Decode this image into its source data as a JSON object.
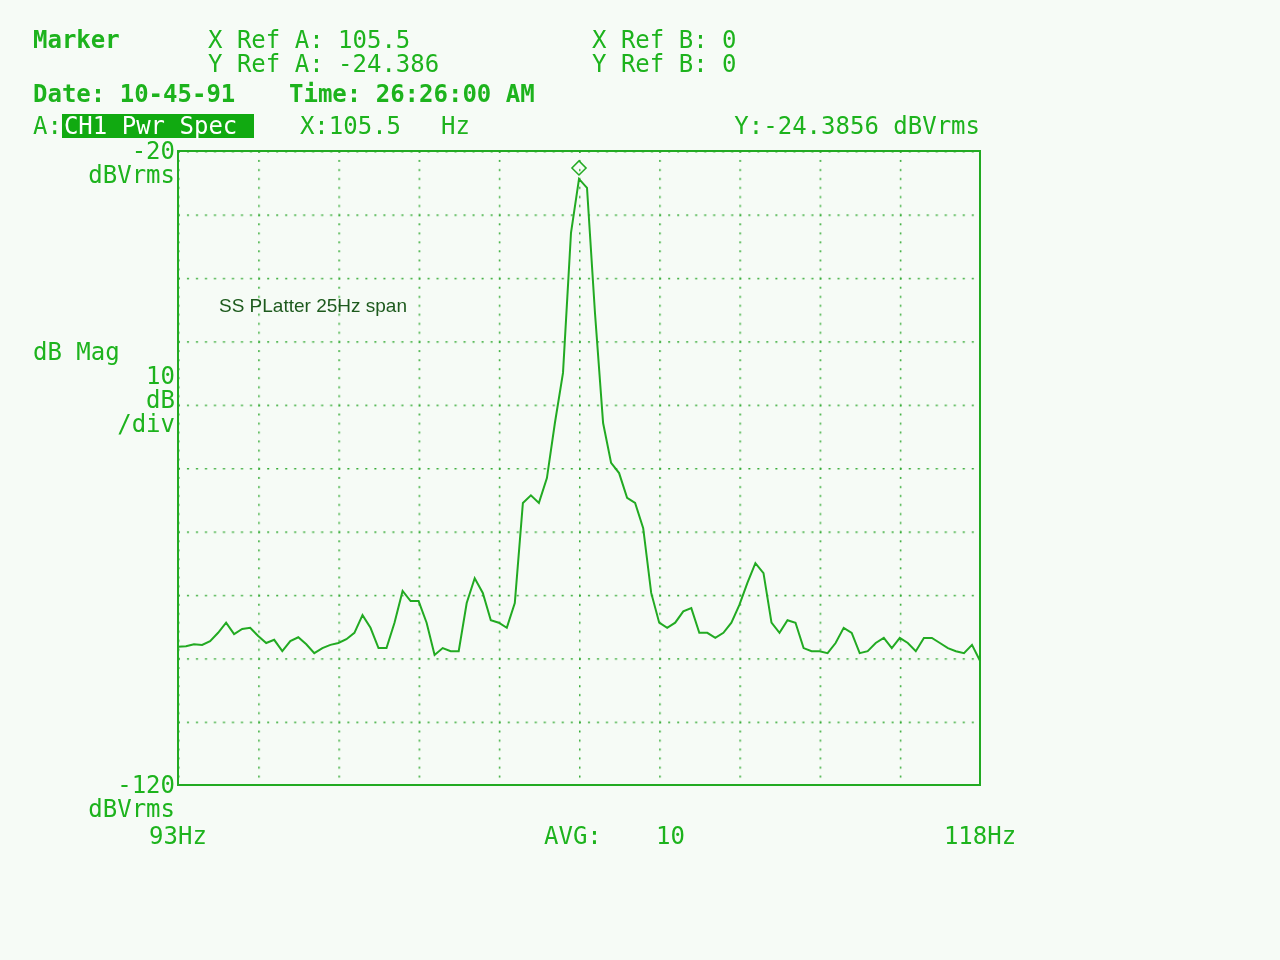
{
  "header": {
    "title": "Marker",
    "refs": [
      {
        "label": "X Ref A:",
        "value": "105.5"
      },
      {
        "label": "X Ref B:",
        "value": "0"
      },
      {
        "label": "Y Ref A:",
        "value": "-24.386"
      },
      {
        "label": "Y Ref B:",
        "value": "0"
      }
    ],
    "date_label": "Date:",
    "date": "10-45-91",
    "time_label": "Time:",
    "time": "26:26:00 AM"
  },
  "trace_bar": {
    "channel": "A:",
    "marker_x": "X:105.5",
    "marker_x_unit": "Hz",
    "marker_y": "Y:-24.3856 dBVrms"
  },
  "axis": {
    "top_unit": "dBVrms",
    "scale_lines": [
      "10",
      "dB",
      "/div"
    ],
    "bottom_unit": "dBVrms"
  },
  "footer": {
    "avg_label": "AVG:",
    "avg_value": "10"
  },
  "chart_data": {
    "type": "line",
    "ylabel": "dB Mag",
    "xlim": [
      93,
      118
    ],
    "ylim": [
      -120,
      -20
    ],
    "xticks": [
      {
        "value": 93,
        "label": "93Hz"
      },
      {
        "value": 118,
        "label": "118Hz"
      }
    ],
    "yticks": [
      {
        "value": -20,
        "label": "-20"
      },
      {
        "value": -120,
        "label": "-120"
      }
    ],
    "x": [
      93,
      93.25,
      93.5,
      93.75,
      94,
      94.25,
      94.5,
      94.75,
      95,
      95.25,
      95.5,
      95.75,
      96,
      96.25,
      96.5,
      96.75,
      97,
      97.25,
      97.5,
      97.75,
      98,
      98.25,
      98.5,
      98.75,
      99,
      99.25,
      99.5,
      99.75,
      100,
      100.25,
      100.5,
      100.75,
      101,
      101.25,
      101.5,
      101.75,
      102,
      102.25,
      102.5,
      102.75,
      103,
      103.25,
      103.5,
      103.75,
      104,
      104.25,
      104.5,
      104.75,
      105,
      105.25,
      105.5,
      105.75,
      106,
      106.25,
      106.5,
      106.75,
      107,
      107.25,
      107.5,
      107.75,
      108,
      108.25,
      108.5,
      108.75,
      109,
      109.25,
      109.5,
      109.75,
      110,
      110.25,
      110.5,
      110.75,
      111,
      111.25,
      111.5,
      111.75,
      112,
      112.25,
      112.5,
      112.75,
      113,
      113.25,
      113.5,
      113.75,
      114,
      114.25,
      114.5,
      114.75,
      115,
      115.25,
      115.5,
      115.75,
      116,
      116.25,
      116.5,
      116.75,
      117,
      117.25,
      117.5,
      117.75,
      118
    ],
    "series": [
      {
        "name": "CH1 Pwr Spec",
        "color": "#22aa22",
        "values": [
          -98.2,
          -98.1,
          -97.8,
          -97.9,
          -97.3,
          -96.0,
          -94.4,
          -96.2,
          -95.4,
          -95.2,
          -96.5,
          -97.6,
          -97.1,
          -98.9,
          -97.3,
          -96.7,
          -97.8,
          -99.2,
          -98.4,
          -97.9,
          -97.6,
          -97.0,
          -96.0,
          -93.2,
          -95.2,
          -98.4,
          -98.4,
          -94.4,
          -89.4,
          -91.0,
          -91.0,
          -94.4,
          -99.5,
          -98.4,
          -98.9,
          -98.9,
          -91.3,
          -87.4,
          -89.7,
          -94.0,
          -94.4,
          -95.2,
          -91.3,
          -75.5,
          -74.3,
          -75.5,
          -71.6,
          -62.9,
          -55.0,
          -32.9,
          -24.4,
          -25.8,
          -45.6,
          -62.9,
          -69.2,
          -70.8,
          -74.7,
          -75.5,
          -79.5,
          -89.7,
          -94.4,
          -95.2,
          -94.4,
          -92.6,
          -92.1,
          -96.0,
          -96.0,
          -96.8,
          -96.0,
          -94.4,
          -91.6,
          -88.1,
          -85.0,
          -86.6,
          -94.4,
          -96.0,
          -94.0,
          -94.4,
          -98.4,
          -98.9,
          -98.9,
          -99.2,
          -97.6,
          -95.2,
          -96.0,
          -99.2,
          -98.9,
          -97.6,
          -96.8,
          -98.4,
          -96.8,
          -97.6,
          -98.9,
          -96.8,
          -96.8,
          -97.6,
          -98.4,
          -98.9,
          -99.2,
          -97.9,
          -100.4
        ]
      }
    ],
    "annotations": [
      "SS PLatter 25Hz span"
    ]
  }
}
